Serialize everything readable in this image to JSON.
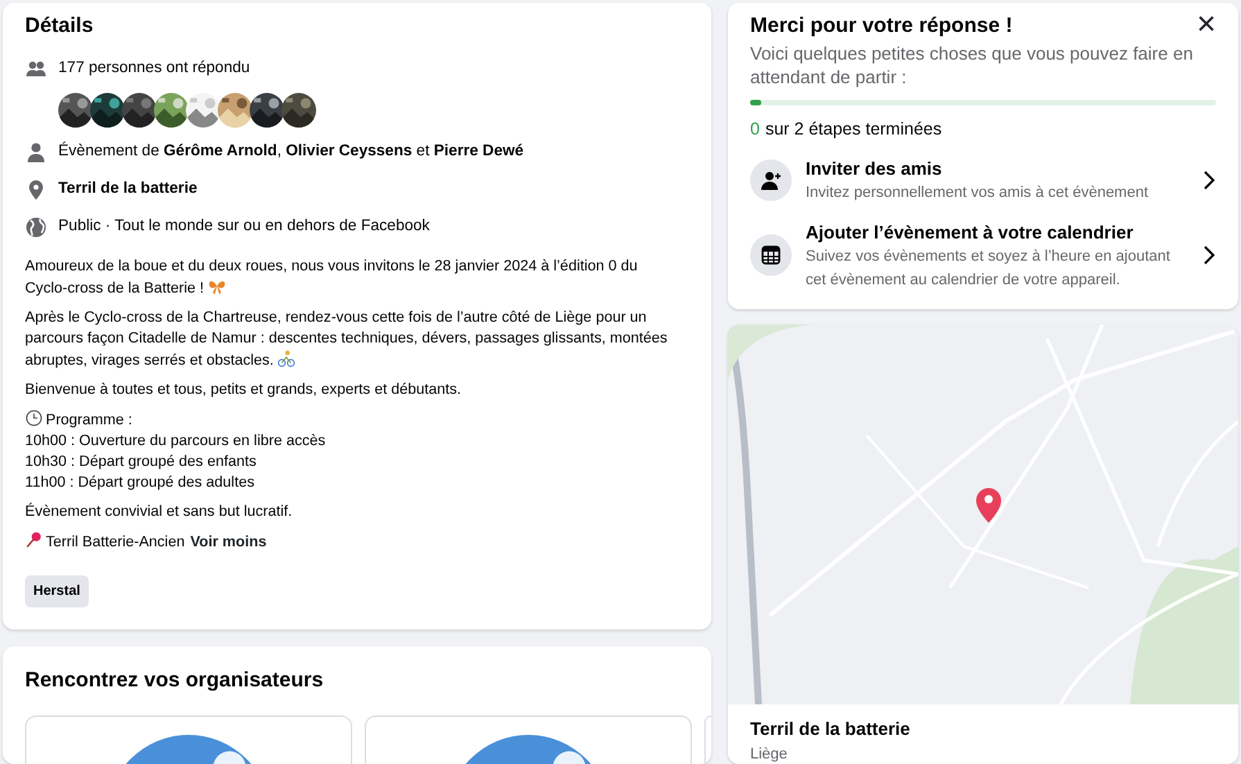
{
  "details": {
    "title": "Détails",
    "info": [
      {
        "kind": "people",
        "text": "177 personnes ont répondu"
      },
      {
        "kind": "avatars",
        "avatars": [
          {
            "kind": "picture"
          },
          {
            "kind": "picture"
          },
          {
            "kind": "picture"
          },
          {
            "kind": "picture"
          },
          {
            "kind": "picture"
          },
          {
            "kind": "picture"
          },
          {
            "kind": "picture"
          },
          {
            "kind": "picture"
          }
        ]
      },
      {
        "kind": "person",
        "text": "Évènement de **Gérôme Arnold**, **Olivier Ceyssens** et **Pierre Dewé**"
      },
      {
        "kind": "location",
        "text": "Terril de la batterie"
      },
      {
        "kind": "globe",
        "text": "Public · Tout le monde sur ou en dehors de Facebook"
      }
    ],
    "description": [
      {
        "kind": "butterfly",
        "lines": [
          "Amoureux de la boue et du deux roues, nous vous invitons le 28 janvier 2024 à l’édition 0 du",
          "Cyclo-cross de la Batterie !"
        ]
      },
      {
        "kind": "cyclist",
        "lines": [
          "Après le Cyclo-cross de la Chartreuse, rendez-vous cette fois de l’autre côté de Liège pour un",
          "parcours façon Citadelle de Namur : descentes techniques, dévers, passages glissants, montées",
          "abruptes, virages serrés et obstacles."
        ]
      },
      {
        "kind": "plain",
        "lines": [
          "Bienvenue à toutes et tous, petits et grands, experts et débutants."
        ]
      },
      {
        "kind": "clock",
        "lines": [
          "Programme :",
          "10h00 : Ouverture du parcours en libre accès",
          "10h30 : Départ groupé des enfants",
          "11h00 : Départ groupé des adultes"
        ]
      },
      {
        "kind": "plain",
        "lines": [
          "Évènement convivial et sans but lucratif."
        ]
      },
      {
        "kind": "pin",
        "lines": [
          "Terril Batterie-Ancien"
        ],
        "link": "Voir moins"
      }
    ],
    "tags": [
      "Herstal"
    ]
  },
  "organizers": {
    "title": "Rencontrez vos organisateurs",
    "cards": [
      {
        "kind": "picture"
      },
      {
        "kind": "picture"
      },
      {
        "kind": "partial"
      }
    ]
  },
  "checklist": {
    "title": "Merci pour votre réponse !",
    "close": "×",
    "subtitle": "Voici quelques petites choses que vous pouvez faire en attendant de partir :",
    "level": 0.02,
    "steps_done": "0",
    "steps_text": "sur 2 étapes terminées",
    "tasks": [
      {
        "kind": "invite",
        "title": "Inviter des amis",
        "subtitle": "Invitez personnellement vos amis à cet évènement"
      },
      {
        "kind": "calendar",
        "title": "Ajouter l’évènement à votre calendrier",
        "subtitle": "Suivez vos évènements et soyez à l’heure en ajoutant cet évènement au calendrier de votre appareil."
      }
    ]
  },
  "map": {
    "place": "Terril de la batterie",
    "city": "Liège"
  }
}
